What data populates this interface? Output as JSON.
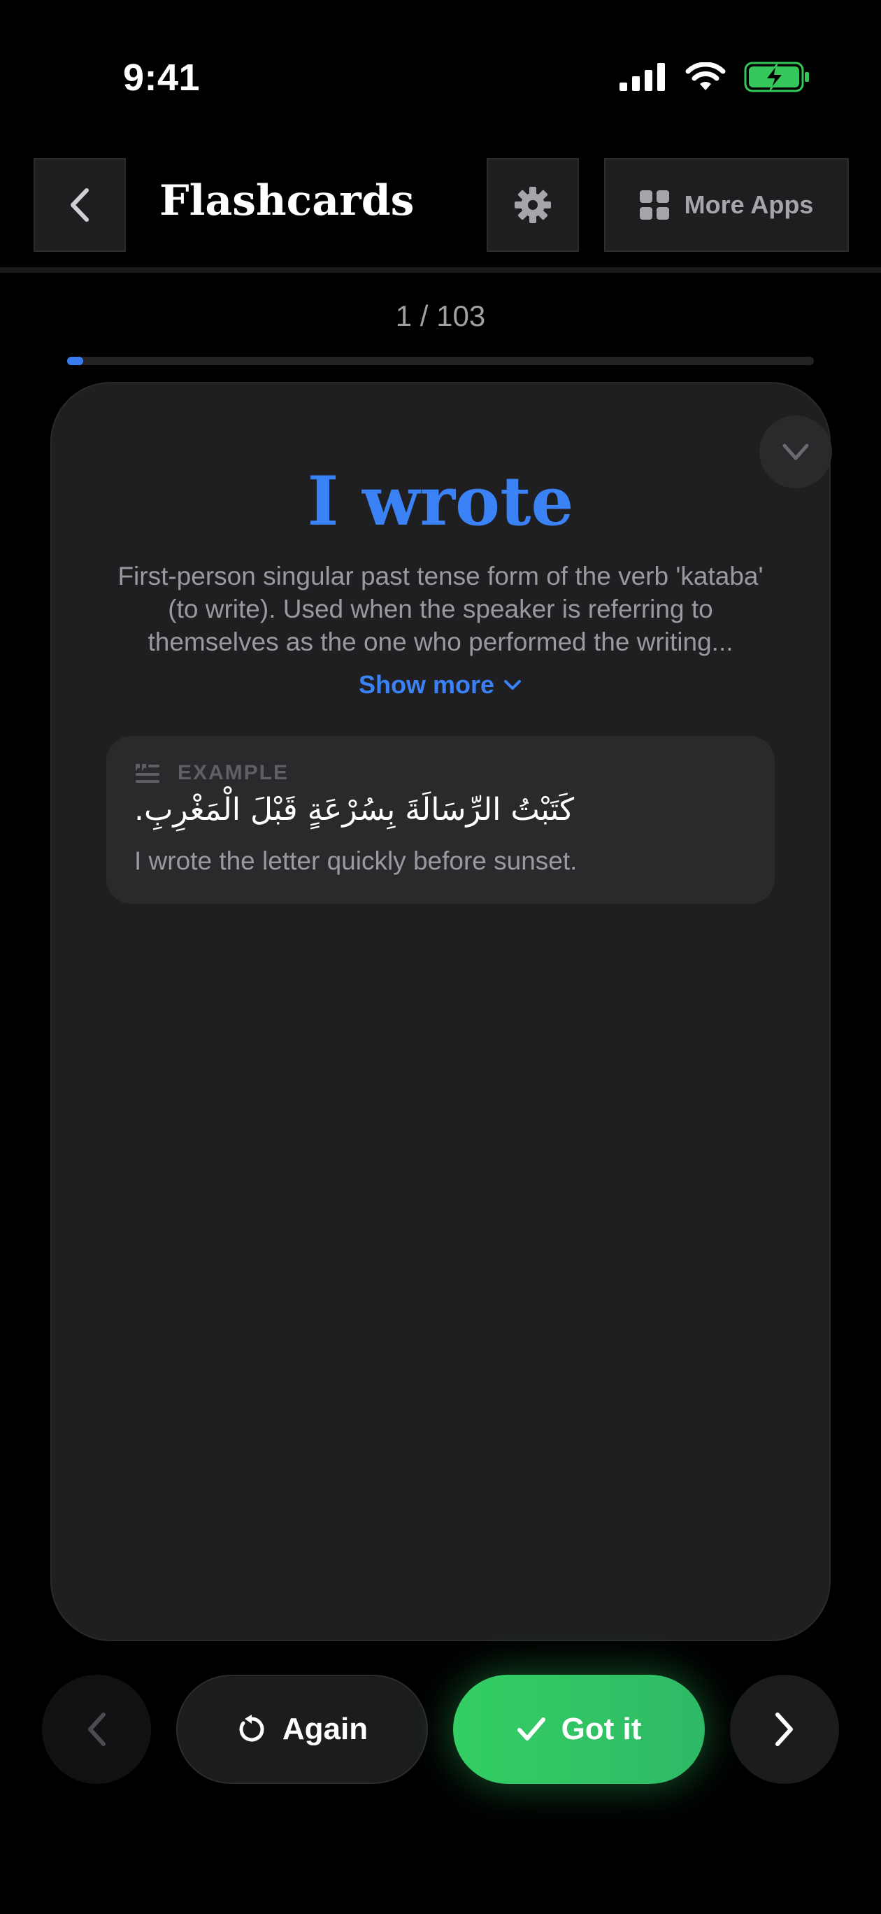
{
  "status_bar": {
    "time": "9:41"
  },
  "header": {
    "title": "Flashcards",
    "more_apps_label": "More Apps"
  },
  "progress": {
    "text": "1 / 103",
    "current": 1,
    "total": 103
  },
  "card": {
    "word": "I wrote",
    "definition": "First-person singular past tense form of the verb 'kataba' (to write). Used when the speaker is referring to themselves as the one who performed the writing...",
    "show_more_label": "Show more",
    "example": {
      "label": "EXAMPLE",
      "arabic": "كَتَبْتُ الرِّسَالَةَ بِسُرْعَةٍ قَبْلَ الْمَغْرِبِ.",
      "translation": "I wrote the letter quickly before sunset."
    }
  },
  "controls": {
    "again_label": "Again",
    "got_it_label": "Got it"
  },
  "colors": {
    "accent_blue": "#3b82f6",
    "success_green": "#33cf63",
    "battery_green": "#34c759"
  }
}
